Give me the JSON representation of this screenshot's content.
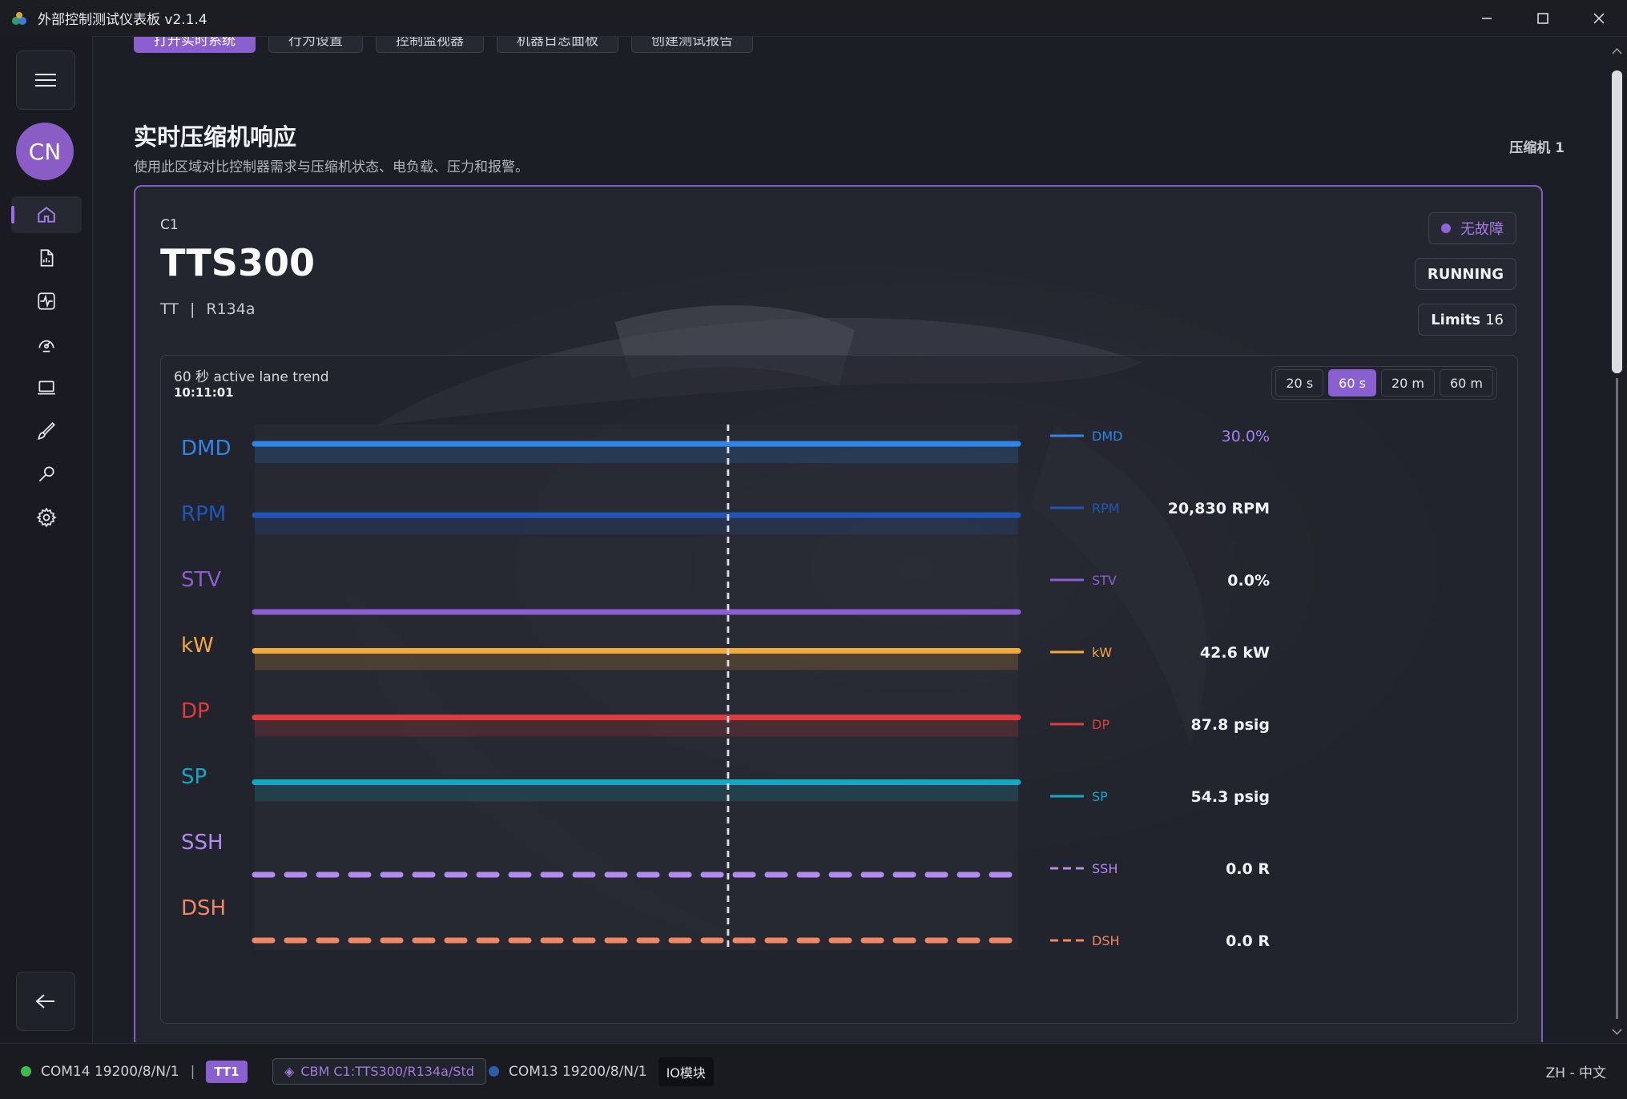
{
  "window": {
    "title": "外部控制测试仪表板 v2.1.4",
    "controls": [
      "minimize-icon",
      "maximize-icon",
      "close-icon"
    ]
  },
  "sidebar": {
    "avatar_initials": "CN",
    "items": [
      {
        "icon": "home-icon",
        "active": true
      },
      {
        "icon": "report-icon",
        "active": false
      },
      {
        "icon": "activity-icon",
        "active": false
      },
      {
        "icon": "gauge-icon",
        "active": false
      },
      {
        "icon": "laptop-icon",
        "active": false
      },
      {
        "icon": "brush-icon",
        "active": false
      },
      {
        "icon": "wrench-icon",
        "active": false
      },
      {
        "icon": "gear-icon",
        "active": false
      }
    ]
  },
  "toolbar": {
    "buttons": [
      "打开实时系统",
      "行为设置",
      "控制监视器",
      "机器日志面板",
      "创建测试报告"
    ]
  },
  "section": {
    "title": "实时压缩机响应",
    "subtitle": "使用此区域对比控制器需求与压缩机状态、电负载、压力和报警。",
    "compressor_label": "压缩机 1"
  },
  "card": {
    "id": "C1",
    "model": "TTS300",
    "type": "TT",
    "separator": "|",
    "refrigerant": "R134a",
    "fault_status": "无故障",
    "run_state": "RUNNING",
    "limits_label": "Limits",
    "limits_count": "16"
  },
  "trend": {
    "title": "60 秒 active lane trend",
    "time": "10:11:01",
    "ranges": [
      {
        "label": "20 s",
        "active": false
      },
      {
        "label": "60 s",
        "active": true
      },
      {
        "label": "20 m",
        "active": false
      },
      {
        "label": "60 m",
        "active": false
      }
    ]
  },
  "chart_data": {
    "type": "line",
    "window_seconds": 60,
    "cursor_fraction": 0.62,
    "series": [
      {
        "name": "DMD",
        "value_text": "30.0%",
        "color": "#2e86e8",
        "level": 0.85,
        "dashed": false
      },
      {
        "name": "RPM",
        "value_text": "20,830 RPM",
        "color": "#1f56b8",
        "level": 0.72,
        "dashed": false
      },
      {
        "name": "STV",
        "value_text": "0.0%",
        "color": "#8a5fd0",
        "level": 0.0,
        "dashed": false
      },
      {
        "name": "kW",
        "value_text": "42.6 kW",
        "color": "#f2a93b",
        "level": 0.62,
        "dashed": false
      },
      {
        "name": "DP",
        "value_text": "87.8 psig",
        "color": "#e03c3c",
        "level": 0.6,
        "dashed": false
      },
      {
        "name": "SP",
        "value_text": "54.3 psig",
        "color": "#14a8c4",
        "level": 0.62,
        "dashed": false
      },
      {
        "name": "SSH",
        "value_text": "0.0 R",
        "color": "#b38af0",
        "level": 0.0,
        "dashed": true
      },
      {
        "name": "DSH",
        "value_text": "0.0 R",
        "color": "#f08866",
        "level": 0.0,
        "dashed": true
      }
    ]
  },
  "statusbar": {
    "port1": "COM14 19200/8/N/1",
    "port1_color": "#3dbb4e",
    "sep": "|",
    "tt1": "TT1",
    "cbm": "CBM C1:TTS300/R134a/Std",
    "port2": "COM13 19200/8/N/1",
    "port2_color": "#2d5da8",
    "io": "IO模块",
    "lang": "ZH - 中文"
  }
}
